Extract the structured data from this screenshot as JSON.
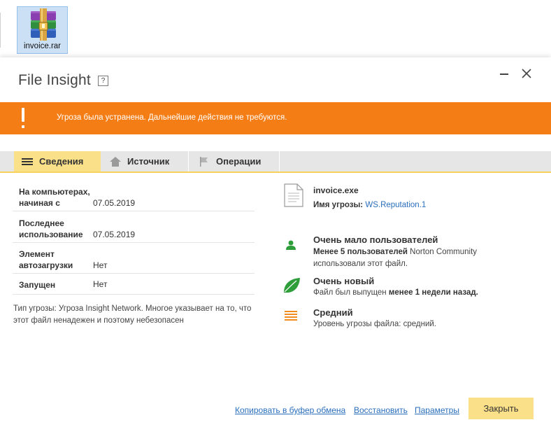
{
  "desktop": {
    "file_name": "invoice.rar",
    "file_icon": "winrar-archive-icon"
  },
  "dialog": {
    "title": "File Insight",
    "help_glyph": "?"
  },
  "alert": {
    "text": "Угроза была устранена. Дальнейшие действия не требуются.",
    "color": "#f57d15"
  },
  "tabs": [
    {
      "label": "Сведения",
      "icon": "list-icon",
      "active": true
    },
    {
      "label": "Источник",
      "icon": "home-icon",
      "active": false
    },
    {
      "label": "Операции",
      "icon": "flag-icon",
      "active": false
    }
  ],
  "details": [
    {
      "label": "На компьютерах, начиная с",
      "value": "07.05.2019"
    },
    {
      "label": "Последнее использование",
      "value": "07.05.2019"
    },
    {
      "label": "Элемент автозагрузки",
      "value": "Нет"
    },
    {
      "label": "Запущен",
      "value": "Нет"
    }
  ],
  "threat_description": "Тип угрозы: Угроза Insight Network. Многое указывает на то, что этот файл ненадежен и поэтому небезопасен",
  "file_info": {
    "name": "invoice.exe",
    "threat_label": "Имя угрозы:",
    "threat_name": "WS.Reputation.1"
  },
  "insights": {
    "users": {
      "title": "Очень мало пользователей",
      "bold": "Менее 5 пользователей",
      "rest": " Norton Community",
      "line2": "использовали этот файл."
    },
    "age": {
      "title": "Очень новый",
      "prefix": "Файл был выпущен ",
      "bold": "менее 1 недели назад."
    },
    "level": {
      "title": "Средний",
      "text": "Уровень угрозы файла: средний."
    }
  },
  "footer": {
    "copy": "Копировать в буфер обмена",
    "restore": "Восстановить",
    "settings": "Параметры",
    "close": "Закрыть"
  },
  "colors": {
    "accent_yellow": "#fbe08a",
    "link_blue": "#2a6ebc",
    "icon_green": "#2e9e3a",
    "icon_orange": "#f08c1e"
  }
}
